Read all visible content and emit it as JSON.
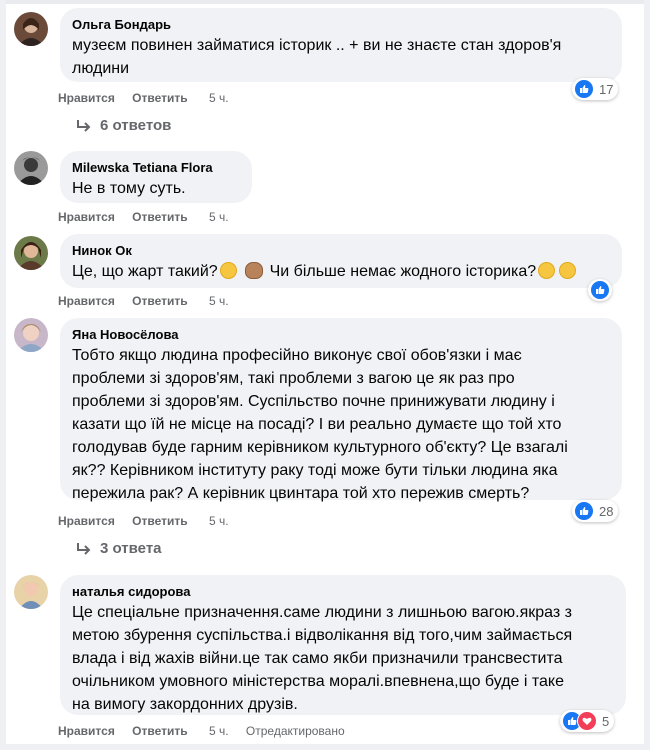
{
  "comments": [
    {
      "author": "Ольга Бондарь",
      "lines": [
        "музеєм повинен займатися історик .. + ви не знаєте стан здоров'я",
        "людини"
      ],
      "like": "Нравится",
      "reply": "Ответить",
      "time": "5 ч.",
      "reactions": "17",
      "replies": "6 ответов"
    },
    {
      "author": "Milewska Tetiana Flora",
      "lines": [
        "Не в тому суть."
      ],
      "like": "Нравится",
      "reply": "Ответить",
      "time": "5 ч."
    },
    {
      "author": "Нинок Ок",
      "text_a": "Це, що жарт такий?",
      "text_b": "Чи більше немає жодного історика?",
      "like": "Нравится",
      "reply": "Ответить",
      "time": "5 ч."
    },
    {
      "author": "Яна Новосёлова",
      "lines": [
        "Тобто якщо людина професійно виконує свої обов'язки і має",
        "проблеми зі здоров'ям, такі проблеми з вагою це як раз про",
        "проблеми зі здоров'ям. Суспільство почне принижувати людину і",
        "казати що їй не місце на посаді? І ви реально думаєте що той хто",
        "голодував буде гарним керівником культурного об'єкту? Це взагалі",
        "як?? Керівником інституту раку тоді може бути тільки людина яка",
        "пережила рак? А керівник цвинтара той хто пережив смерть?"
      ],
      "like": "Нравится",
      "reply": "Ответить",
      "time": "5 ч.",
      "reactions": "28",
      "replies": "3 ответа"
    },
    {
      "author": "наталья сидорова",
      "lines": [
        "Це спеціальне призначення.саме людини з лишньою вагою.якраз з",
        "метою збурення суспільства.і відволікання від того,чим займається",
        "влада і від жахів війни.це так само якби призначили трансвестита",
        "очільником умовного міністерства моралі.впевнена,що буде і таке",
        "на вимогу закордонних друзів."
      ],
      "like": "Нравится",
      "reply": "Ответить",
      "time": "5 ч.",
      "edited": "Отредактировано",
      "reactions": "5"
    }
  ],
  "colors": {
    "bubble": "#f0f2f5",
    "meta": "#65676b",
    "like": "#1877f2",
    "love": "#f33e58"
  }
}
